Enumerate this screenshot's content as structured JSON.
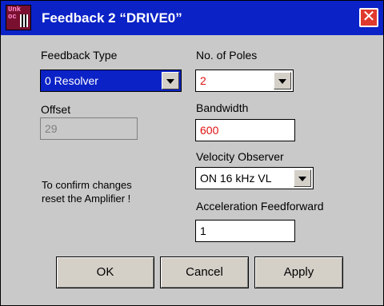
{
  "window": {
    "title": "Feedback 2 “DRIVE0”",
    "close_glyph": "✕",
    "app_icon": "unk-app-icon"
  },
  "feedback_type": {
    "label": "Feedback Type",
    "value": "0 Resolver"
  },
  "poles": {
    "label": "No. of Poles",
    "value": "2"
  },
  "offset": {
    "label": "Offset",
    "value": "29"
  },
  "bandwidth": {
    "label": "Bandwidth",
    "value": "600"
  },
  "velocity_observer": {
    "label": "Velocity Observer",
    "value": "ON 16 kHz VL"
  },
  "note": {
    "line1": "To confirm changes",
    "line2": "reset the Amplifier !"
  },
  "accel_ff": {
    "label": "Acceleration Feedforward",
    "value": "1"
  },
  "buttons": {
    "ok": "OK",
    "cancel": "Cancel",
    "apply": "Apply"
  },
  "colors": {
    "titlebar": "#0b22c6",
    "dialog_bg": "#c9c9c9",
    "value_red": "#e01010",
    "close": "#e03a2e"
  }
}
